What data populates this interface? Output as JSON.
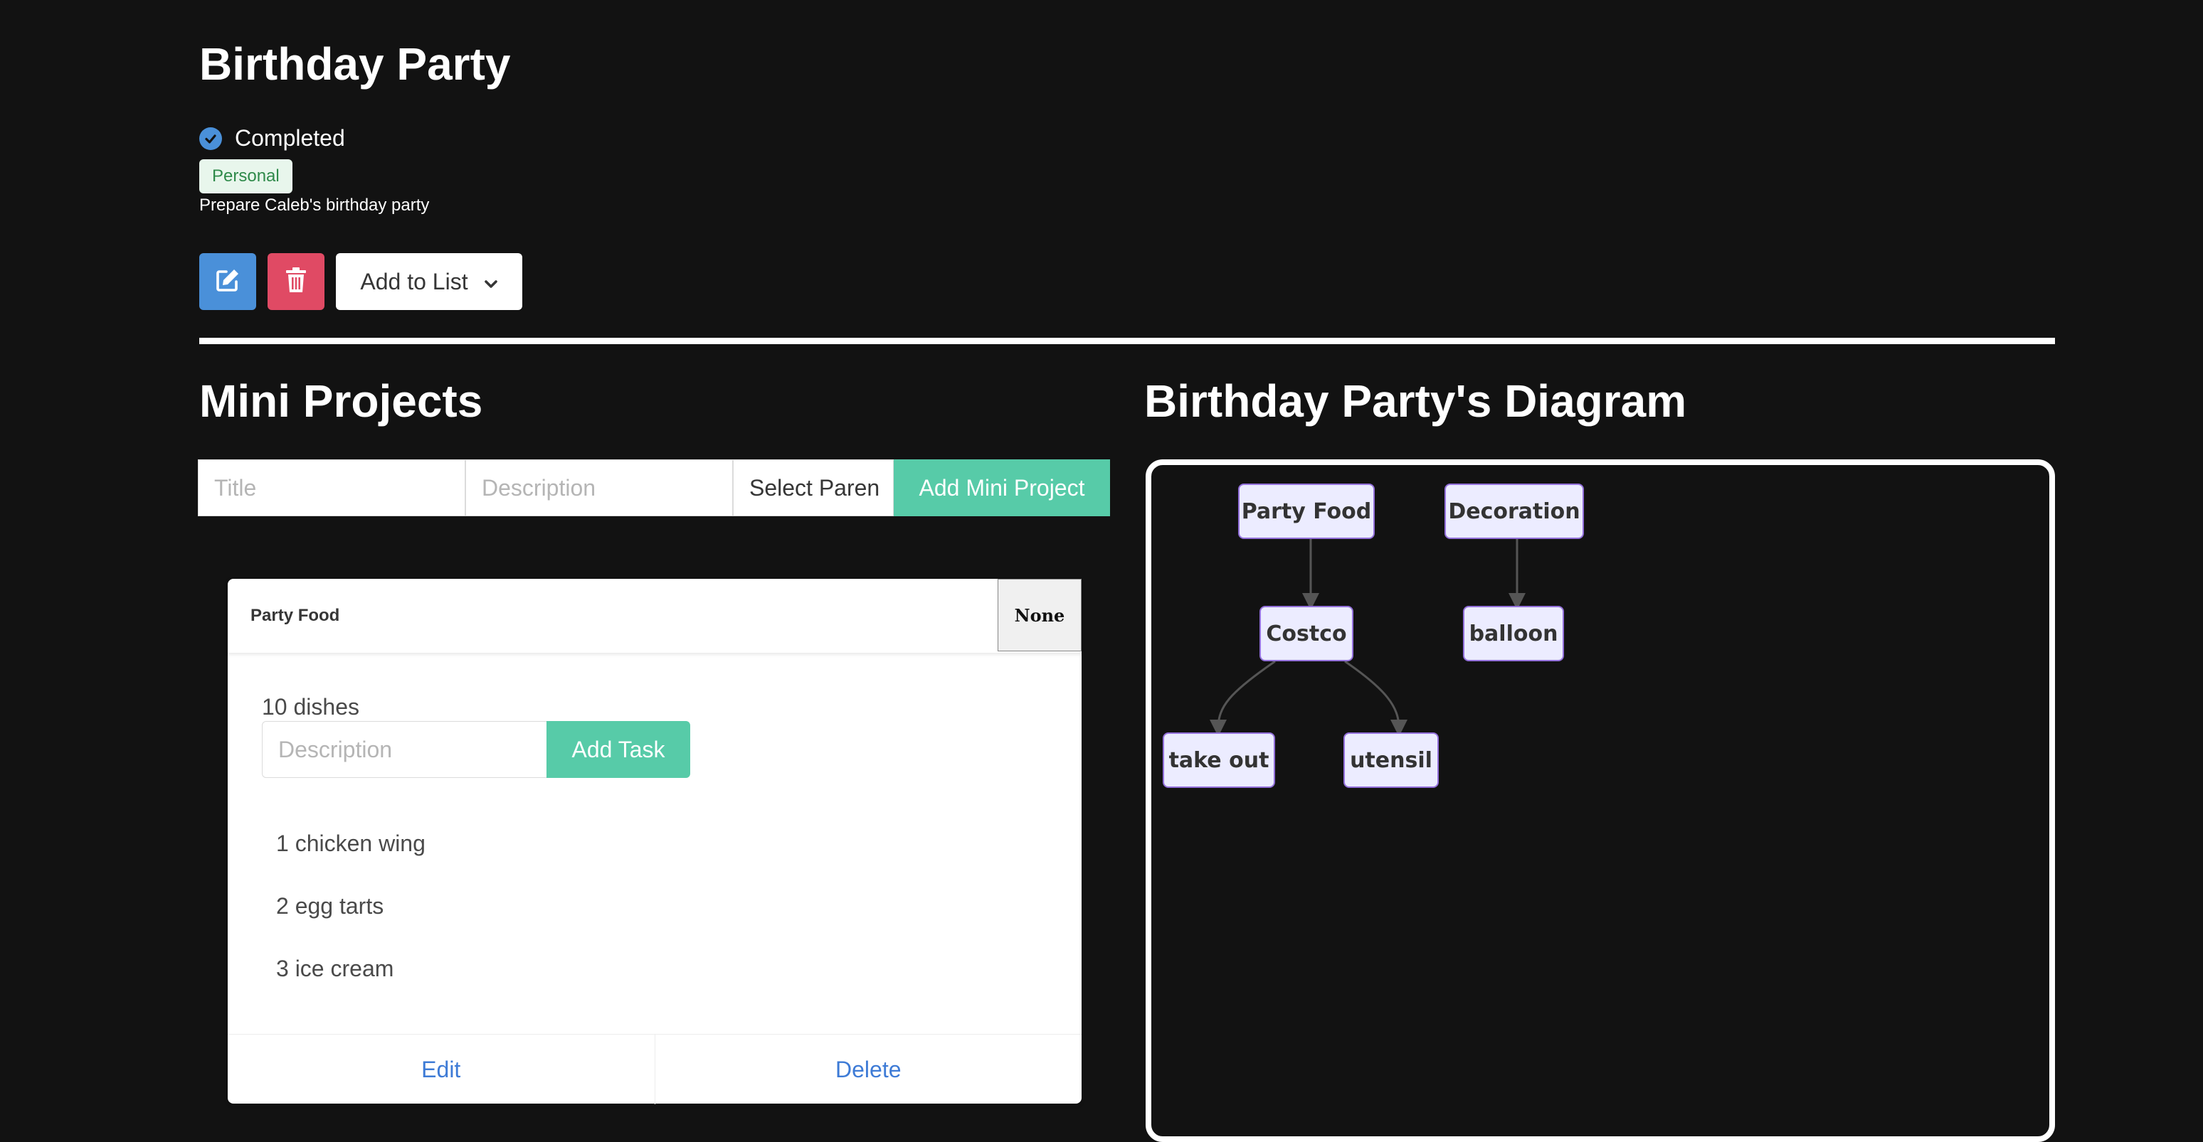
{
  "project": {
    "title": "Birthday Party",
    "status": "Completed",
    "tag": "Personal",
    "description": "Prepare Caleb's birthday party"
  },
  "actions": {
    "edit_icon": "edit-icon",
    "delete_icon": "trash-icon",
    "add_to_list_label": "Add to List"
  },
  "mini_projects": {
    "heading": "Mini Projects",
    "form": {
      "title_placeholder": "Title",
      "description_placeholder": "Description",
      "select_parent_label": "Select Paren",
      "add_button_label": "Add Mini Project"
    },
    "card": {
      "title": "Party Food",
      "parent_value": "None",
      "subtitle": "10 dishes",
      "task_placeholder": "Description",
      "add_task_label": "Add Task",
      "tasks": [
        "1 chicken wing",
        "2 egg tarts",
        "3 ice cream"
      ],
      "edit_label": "Edit",
      "delete_label": "Delete"
    }
  },
  "diagram": {
    "heading": "Birthday Party's Diagram",
    "nodes": {
      "party_food": "Party Food",
      "decoration": "Decoration",
      "costco": "Costco",
      "balloon": "balloon",
      "take_out": "take out",
      "utensil": "utensil"
    }
  },
  "colors": {
    "background": "#121212",
    "edit_button": "#4a90d9",
    "delete_button": "#e04a64",
    "accent_green": "#57cba8",
    "link_blue": "#3e7bd6",
    "node_fill": "#ececff",
    "node_border": "#9370db"
  }
}
